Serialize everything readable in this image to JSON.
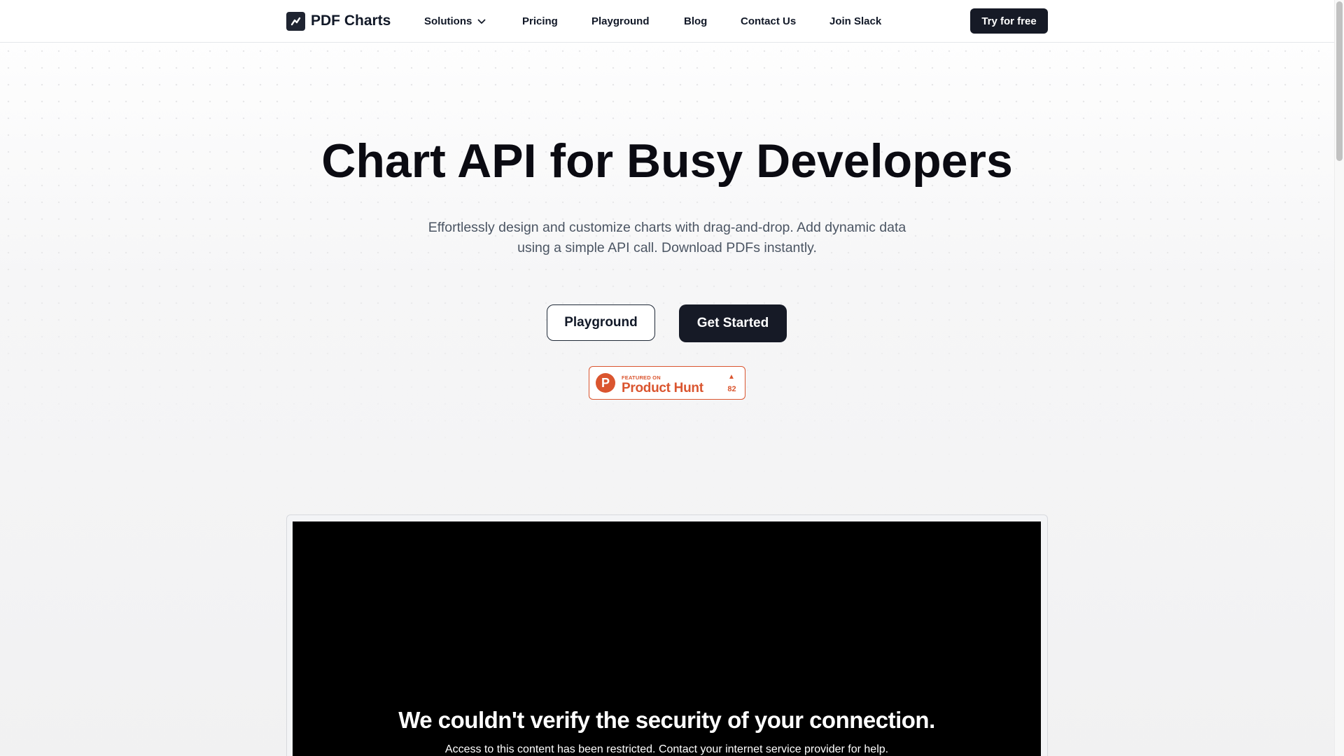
{
  "header": {
    "brand": "PDF Charts",
    "nav": [
      {
        "label": "Solutions",
        "has_dropdown": true
      },
      {
        "label": "Pricing"
      },
      {
        "label": "Playground"
      },
      {
        "label": "Blog"
      },
      {
        "label": "Contact Us"
      },
      {
        "label": "Join Slack"
      }
    ],
    "cta": "Try for free"
  },
  "hero": {
    "title": "Chart API for Busy Developers",
    "subtitle_line1": "Effortlessly design and customize charts with drag-and-drop. Add dynamic data",
    "subtitle_line2": "using a simple API call. Download PDFs instantly.",
    "secondary_button": "Playground",
    "primary_button": "Get Started"
  },
  "product_hunt": {
    "featured": "FEATURED ON",
    "name": "Product Hunt",
    "votes": "82",
    "logo_letter": "P"
  },
  "embed": {
    "title": "We couldn't verify the security of your connection.",
    "message": "Access to this content has been restricted. Contact your internet service provider for help."
  },
  "colors": {
    "primary": "#161a26",
    "product_hunt": "#da552f",
    "embed_bg": "#000000"
  }
}
